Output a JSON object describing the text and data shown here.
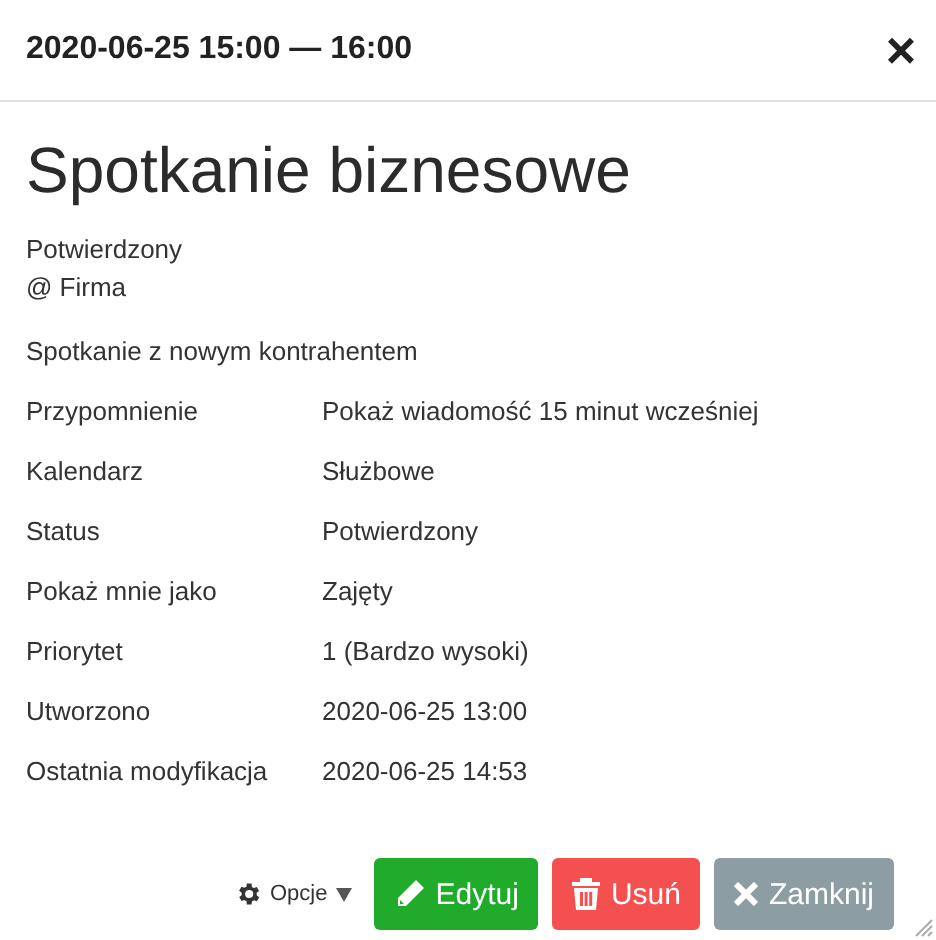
{
  "header": {
    "title": "2020-06-25 15:00 — 16:00",
    "close": "×"
  },
  "event": {
    "title": "Spotkanie biznesowe",
    "status": "Potwierdzony",
    "location": "@ Firma",
    "description": "Spotkanie z nowym kontrahentem"
  },
  "details": [
    {
      "label": "Przypomnienie",
      "value": "Pokaż wiadomość 15 minut wcześniej"
    },
    {
      "label": "Kalendarz",
      "value": "Służbowe"
    },
    {
      "label": "Status",
      "value": "Potwierdzony"
    },
    {
      "label": "Pokaż mnie jako",
      "value": "Zajęty"
    },
    {
      "label": "Priorytet",
      "value": "1 (Bardzo wysoki)"
    },
    {
      "label": "Utworzono",
      "value": "2020-06-25 13:00"
    },
    {
      "label": "Ostatnia modyfikacja",
      "value": "2020-06-25 14:53"
    }
  ],
  "footer": {
    "options": "Opcje",
    "buttons": [
      {
        "kind": "edit",
        "label": "Edytuj"
      },
      {
        "kind": "delete",
        "label": "Usuń"
      },
      {
        "kind": "close",
        "label": "Zamknij"
      }
    ]
  }
}
